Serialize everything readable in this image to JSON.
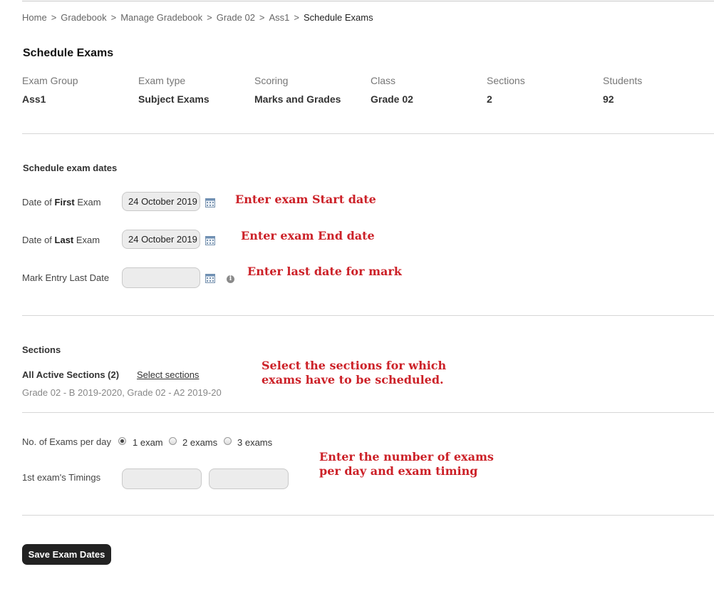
{
  "breadcrumb": {
    "items": [
      "Home",
      "Gradebook",
      "Manage Gradebook",
      "Grade 02",
      "Ass1"
    ],
    "current": "Schedule Exams",
    "separator": ">"
  },
  "page_title": "Schedule Exams",
  "exam_info": {
    "labels": [
      "Exam Group",
      "Exam type",
      "Scoring",
      "Class",
      "Sections",
      "Students"
    ],
    "values": [
      "Ass1",
      "Subject Exams",
      "Marks and Grades",
      "Grade 02",
      "2",
      "92"
    ]
  },
  "schedule_dates": {
    "heading": "Schedule exam dates",
    "first_exam": {
      "label_pre": "Date of ",
      "label_bold": "First",
      "label_post": " Exam",
      "value": "24 October 2019"
    },
    "last_exam": {
      "label_pre": "Date of ",
      "label_bold": "Last",
      "label_post": " Exam",
      "value": "24 October 2019"
    },
    "mark_entry": {
      "label": "Mark Entry Last Date",
      "value": ""
    },
    "calendar_icon": "calendar-icon",
    "info_icon": "info-icon"
  },
  "sections": {
    "heading": "Sections",
    "all_active": "All Active Sections (2)",
    "select_link": "Select sections",
    "list": "Grade 02 - B 2019-2020, Grade 02 - A2 2019-20"
  },
  "exams_per_day": {
    "label": "No. of Exams per day",
    "options": [
      "1 exam",
      "2 exams",
      "3 exams"
    ],
    "selected": "1 exam",
    "timings_label": "1st exam's Timings"
  },
  "save_button": "Save Exam Dates",
  "annotations": {
    "start_date": "Enter exam Start date",
    "end_date": "Enter exam End date",
    "mark_date": "Enter last date for mark",
    "sections_line1": "Select the sections for which",
    "sections_line2": "exams have to be scheduled.",
    "exams_line1": "Enter the number of exams",
    "exams_line2": "per day and exam timing"
  },
  "colors": {
    "annotation": "#cc2128",
    "button_bg": "#222222",
    "input_bg": "#ececec"
  }
}
